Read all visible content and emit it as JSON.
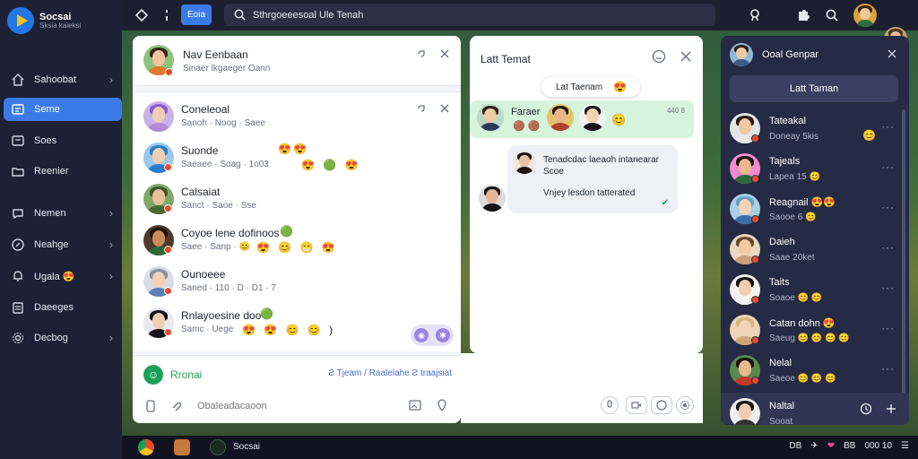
{
  "brand": {
    "title": "Socsai",
    "subtitle": "Sksia kaieksi"
  },
  "sidebar": {
    "items": [
      {
        "label": "Sahoobat",
        "icon": "home-icon"
      },
      {
        "label": "Seme",
        "icon": "chat-icon"
      },
      {
        "label": "Soes",
        "icon": "message-icon"
      },
      {
        "label": "Reenier",
        "icon": "folder-icon"
      },
      {
        "label": "Nemen",
        "icon": "bubble-icon"
      },
      {
        "label": "Neahge",
        "icon": "compass-icon"
      },
      {
        "label": "Ugala 😍",
        "icon": "bell-icon"
      },
      {
        "label": "Daeeges",
        "icon": "clipboard-icon"
      },
      {
        "label": "Decbog",
        "icon": "gear-icon"
      }
    ]
  },
  "topbar": {
    "edit_label": "Eoia",
    "search_value": "Sthrgoeeesoal Ule Tenah",
    "search_placeholder": "Search"
  },
  "left_panel": {
    "top_card": {
      "name": "Nav Eenbaan",
      "sub": "Sinaer lkgaeger Oann"
    },
    "chats": [
      {
        "name": "Coneleoal",
        "meta": "Sanoh · Noog · Saee",
        "reacts": "",
        "name_reacts": ""
      },
      {
        "name": "Suonde",
        "meta": "Saeaee · Soag · 1o03",
        "reacts": "😍 🟢 😍",
        "name_reacts": "😍😍"
      },
      {
        "name": "Calsaiat",
        "meta": "Sanct · Saoe · Sse",
        "reacts": "",
        "name_reacts": ""
      },
      {
        "name": "Coyoe lene dofinoos",
        "meta": "Saee · Sanp · 😊",
        "reacts": "😍 😊 😁 😍",
        "name_reacts": "🟢"
      },
      {
        "name": "Ounoeee",
        "meta": "Saned · 110 · D · D1 · 7",
        "reacts": "",
        "name_reacts": ""
      },
      {
        "name": "Rnlayoesine doo",
        "meta": "Samc · Uege",
        "reacts": "😍 😍 😊 😊 )",
        "name_reacts": "🟢"
      }
    ],
    "composer": {
      "brand_label": "Rronai",
      "links": "Ƨ Tjeam / Raalelahe Ƨ traajsiat",
      "input_placeholder": "Obaleadacaoon"
    }
  },
  "mid_panel": {
    "title": "Latt Temat",
    "pill_label": "Lat Taenam",
    "pill_emoji": "😍",
    "green_card": {
      "label": "Faraer",
      "meta": "440 8",
      "emoji": "😊"
    },
    "bubble": {
      "line1": "Tenadcdac laeaoh intanearar Scoe",
      "line2": "Vnjey lesdon tatterated"
    }
  },
  "right_panel": {
    "title": "Ooal Genpar",
    "tab_label": "Latt Taman",
    "friends": [
      {
        "name": "Tateakal",
        "sub": "Doneay 5kis",
        "emoji": "😊"
      },
      {
        "name": "Tajeals",
        "sub": "Lapea 15 😊",
        "emoji": ""
      },
      {
        "name": "Reagnail 😍😍",
        "sub": "Saooe 6 😊",
        "emoji": ""
      },
      {
        "name": "Daieh",
        "sub": "Saae 20ket",
        "emoji": ""
      },
      {
        "name": "Taits",
        "sub": "Soaoe 😊 😊",
        "emoji": ""
      },
      {
        "name": "Catan dohn 😍",
        "sub": "Saeug 😊 😊 😊 😊",
        "emoji": ""
      },
      {
        "name": "Nelal",
        "sub": "Saeoe 😊 😊 😊",
        "emoji": ""
      },
      {
        "name": "Naltal",
        "sub": "Sooat",
        "emoji": ""
      }
    ]
  },
  "taskbar": {
    "label": "Socsai",
    "tray": [
      "DB",
      "✈",
      "❤",
      "BB",
      "000 10"
    ]
  },
  "colors": {
    "accent": "#3b7be8",
    "sidebar": "#1c2135",
    "right_panel": "#262b45",
    "green": "#1fa05a"
  }
}
